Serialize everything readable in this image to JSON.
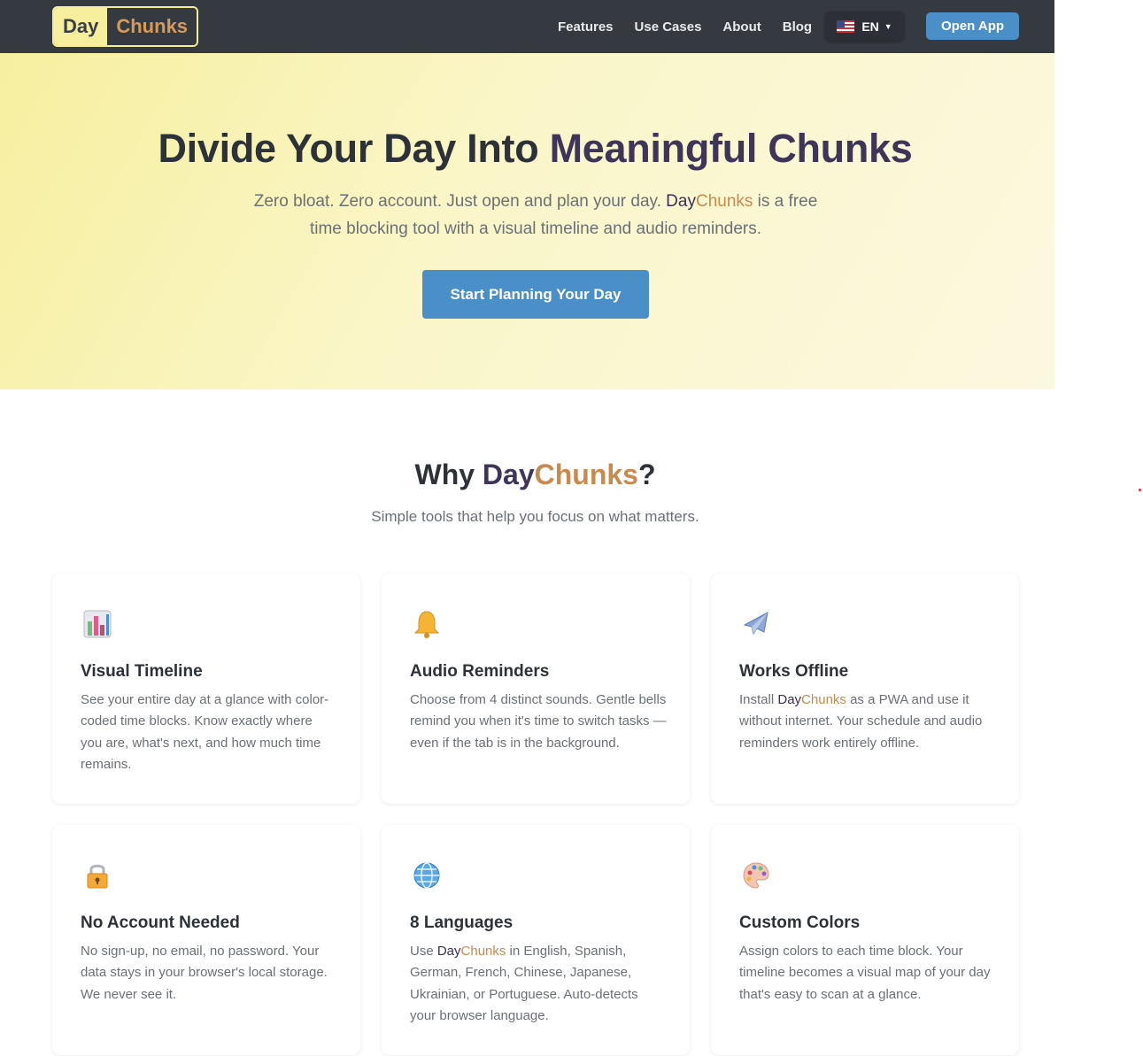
{
  "nav": {
    "logo_day": "Day",
    "logo_chunks": "Chunks",
    "links": [
      "Features",
      "Use Cases",
      "About",
      "Blog"
    ],
    "language": "EN",
    "open_app": "Open App"
  },
  "hero": {
    "title_part1": "Divide Your Day Into ",
    "title_part2": "Meaningful Chunks",
    "sub_part1": "Zero bloat. Zero account. Just open and plan your day. ",
    "brand_day": "Day",
    "brand_chunks": "Chunks",
    "sub_part2": " is a free time blocking tool with a visual timeline and audio reminders.",
    "cta": "Start Planning Your Day"
  },
  "why": {
    "title_prefix": "Why ",
    "title_day": "Day",
    "title_chunks": "Chunks",
    "title_suffix": "?",
    "subtitle": "Simple tools that help you focus on what matters."
  },
  "features": [
    {
      "icon": "bar-chart-icon",
      "title": "Visual Timeline",
      "desc": "See your entire day at a glance with color-coded time blocks. Know exactly where you are, what's next, and how much time remains."
    },
    {
      "icon": "bell-icon",
      "title": "Audio Reminders",
      "desc": "Choose from 4 distinct sounds. Gentle bells remind you when it's time to switch tasks — even if the tab is in the background."
    },
    {
      "icon": "airplane-icon",
      "title": "Works Offline",
      "desc_part1": "Install ",
      "desc_day": "Day",
      "desc_chunks": "Chunks",
      "desc_part2": " as a PWA and use it without internet. Your schedule and audio reminders work entirely offline."
    },
    {
      "icon": "lock-icon",
      "title": "No Account Needed",
      "desc": "No sign-up, no email, no password. Your data stays in your browser's local storage. We never see it."
    },
    {
      "icon": "globe-icon",
      "title": "8 Languages",
      "desc_part1": "Use ",
      "desc_day": "Day",
      "desc_chunks": "Chunks",
      "desc_part2": " in English, Spanish, German, French, Chinese, Japanese, Ukrainian, or Portuguese. Auto-detects your browser language."
    },
    {
      "icon": "palette-icon",
      "title": "Custom Colors",
      "desc": "Assign colors to each time block. Your timeline becomes a visual map of your day that's easy to scan at a glance."
    }
  ]
}
